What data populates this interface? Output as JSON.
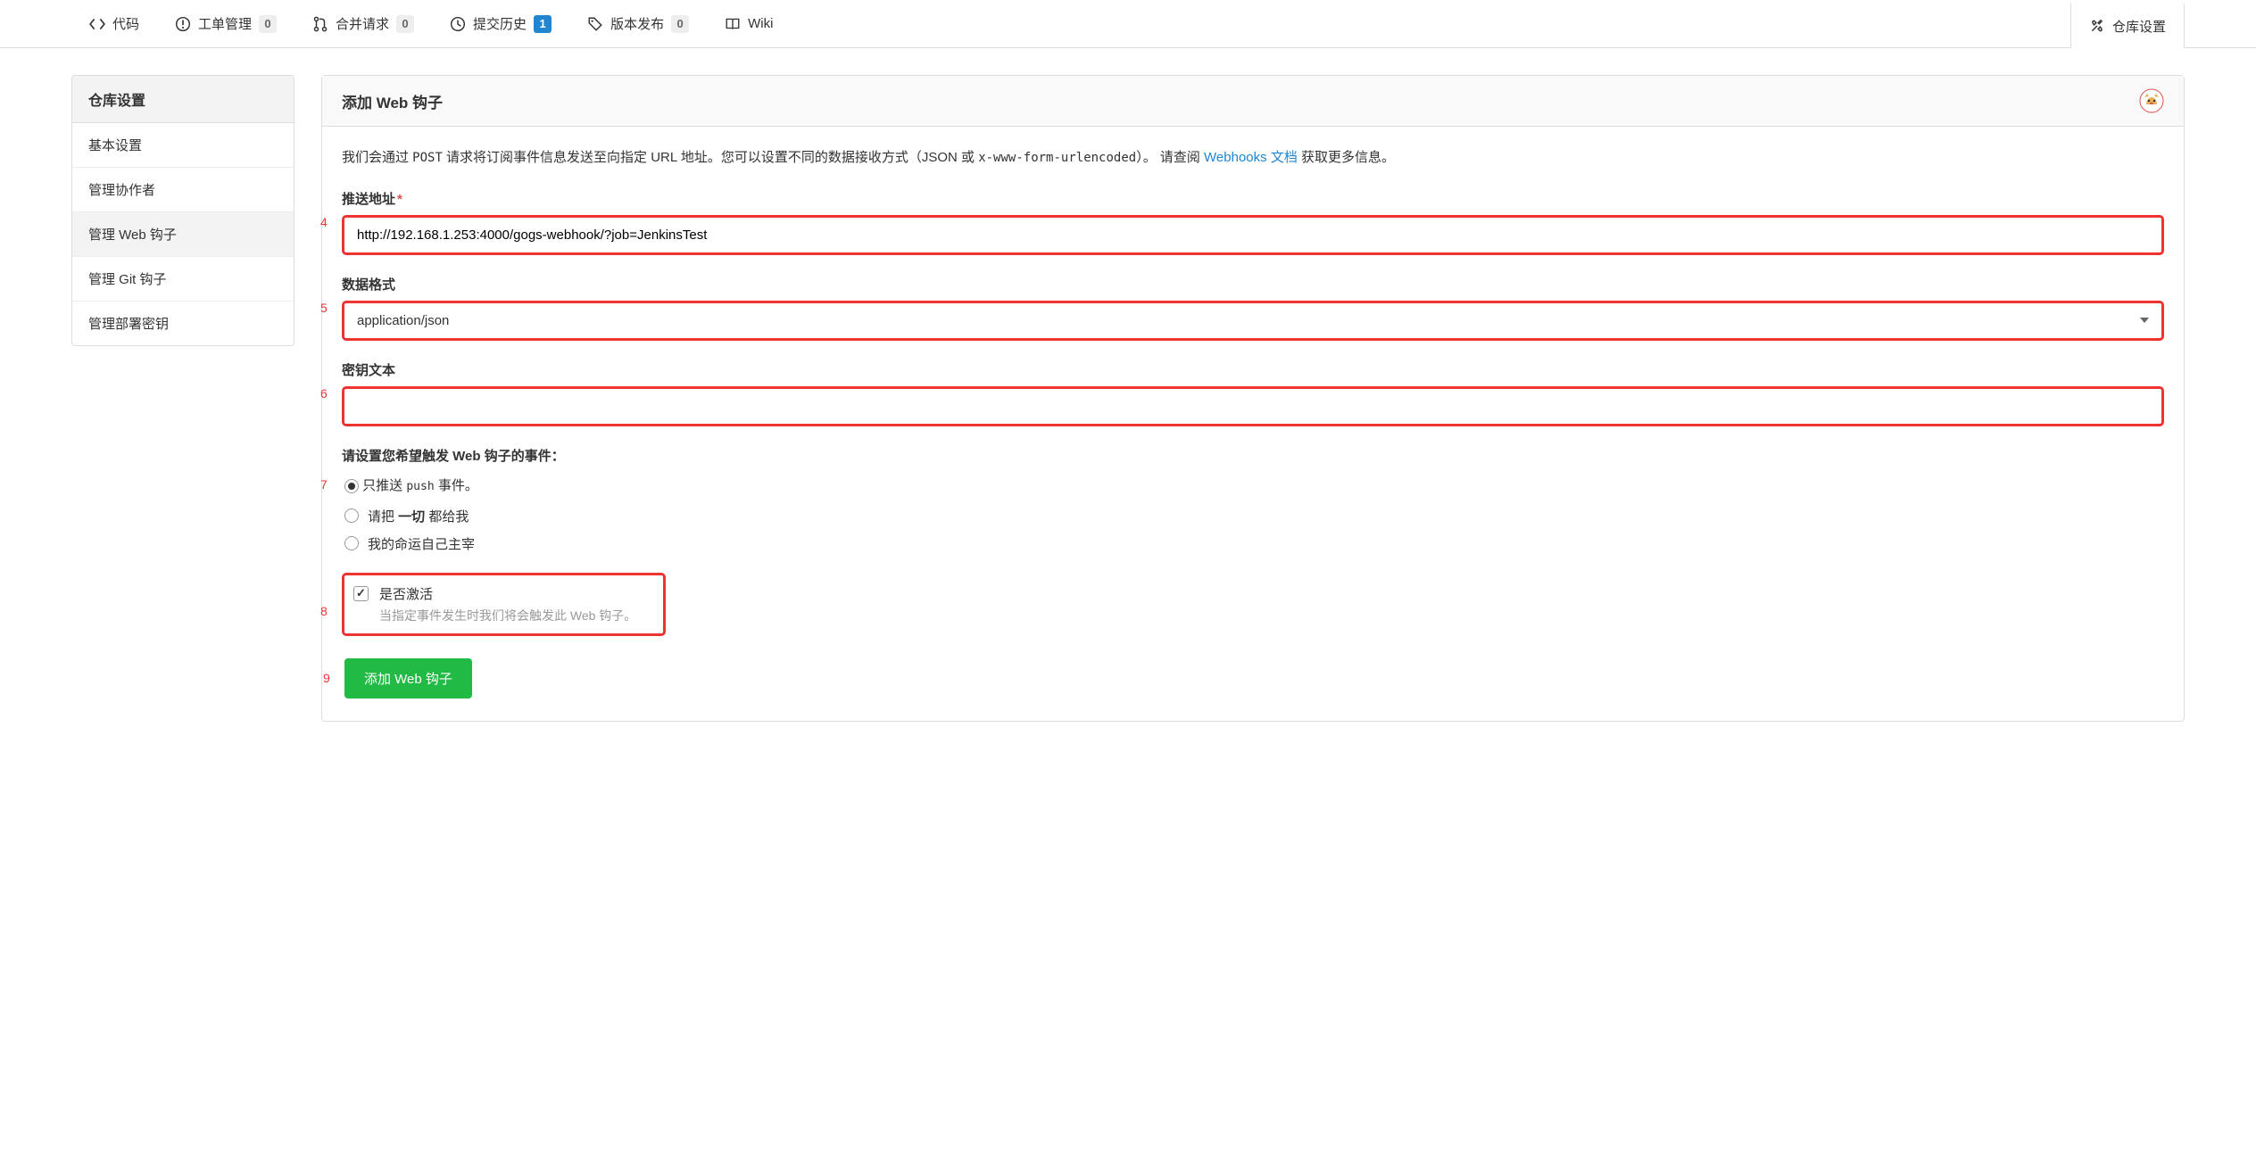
{
  "nav": {
    "items": [
      {
        "label": "代码",
        "icon": "code-icon",
        "badge": null
      },
      {
        "label": "工单管理",
        "icon": "issue-icon",
        "badge": "0"
      },
      {
        "label": "合并请求",
        "icon": "pr-icon",
        "badge": "0"
      },
      {
        "label": "提交历史",
        "icon": "history-icon",
        "badge": "1",
        "badgeBlue": true
      },
      {
        "label": "版本发布",
        "icon": "tag-icon",
        "badge": "0"
      },
      {
        "label": "Wiki",
        "icon": "book-icon",
        "badge": null
      }
    ],
    "settings": {
      "label": "仓库设置",
      "icon": "tools-icon"
    }
  },
  "sidebar": {
    "header": "仓库设置",
    "items": [
      {
        "label": "基本设置"
      },
      {
        "label": "管理协作者"
      },
      {
        "label": "管理 Web 钩子",
        "active": true
      },
      {
        "label": "管理 Git 钩子"
      },
      {
        "label": "管理部署密钥"
      }
    ]
  },
  "main": {
    "title": "添加 Web 钩子",
    "intro": {
      "p1a": "我们会通过 ",
      "code1": "POST",
      "p1b": " 请求将订阅事件信息发送至向指定 URL 地址。您可以设置不同的数据接收方式（JSON 或 ",
      "code2": "x-www-form-urlencoded",
      "p1c": "）。 请查阅 ",
      "link": "Webhooks 文档",
      "p1d": " 获取更多信息。"
    },
    "form": {
      "payloadUrl": {
        "label": "推送地址",
        "value": "http://192.168.1.253:4000/gogs-webhook/?job=JenkinsTest"
      },
      "contentType": {
        "label": "数据格式",
        "value": "application/json"
      },
      "secret": {
        "label": "密钥文本",
        "value": ""
      },
      "events": {
        "label": "请设置您希望触发 Web 钩子的事件：",
        "options": [
          {
            "pre": "只推送 ",
            "code": "push",
            "post": " 事件。",
            "checked": true
          },
          {
            "pre": "请把 ",
            "bold": "一切",
            "post": " 都给我",
            "checked": false
          },
          {
            "pre": "我的命运自己主宰",
            "checked": false
          }
        ]
      },
      "active": {
        "label": "是否激活",
        "sub": "当指定事件发生时我们将会触发此 Web 钩子。",
        "checked": true
      },
      "submit": "添加 Web 钩子"
    }
  },
  "annotations": {
    "4": "4",
    "5": "5",
    "6": "6",
    "7": "7",
    "8": "8",
    "9": "9"
  }
}
